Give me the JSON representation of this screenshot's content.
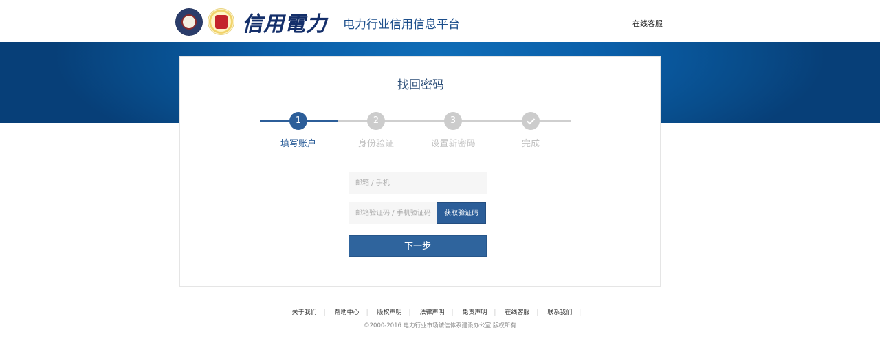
{
  "header": {
    "logo_text": "信用電力",
    "platform_title": "电力行业信用信息平台",
    "service_link": "在线客服"
  },
  "card": {
    "title": "找回密码",
    "steps": [
      {
        "number": "1",
        "label": "填写账户",
        "state": "active"
      },
      {
        "number": "2",
        "label": "身份验证",
        "state": "pending"
      },
      {
        "number": "3",
        "label": "设置新密码",
        "state": "pending"
      },
      {
        "number": "check-icon",
        "label": "完成",
        "state": "pending"
      }
    ],
    "account_field": {
      "placeholder": "邮箱 / 手机",
      "value": ""
    },
    "code_field": {
      "placeholder": "邮箱验证码 / 手机验证码",
      "value": ""
    },
    "get_code_label": "获取验证码",
    "next_label": "下一步"
  },
  "footer": {
    "links": [
      "关于我们",
      "帮助中心",
      "版权声明",
      "法律声明",
      "免责声明",
      "在线客服",
      "联系我们"
    ],
    "copyright": "©2000-2016 电力行业市场诚信体系建设办公室 版权所有"
  },
  "colors": {
    "primary": "#2c5e99",
    "banner": "#0a5ea8",
    "inactive": "#cccccc"
  }
}
